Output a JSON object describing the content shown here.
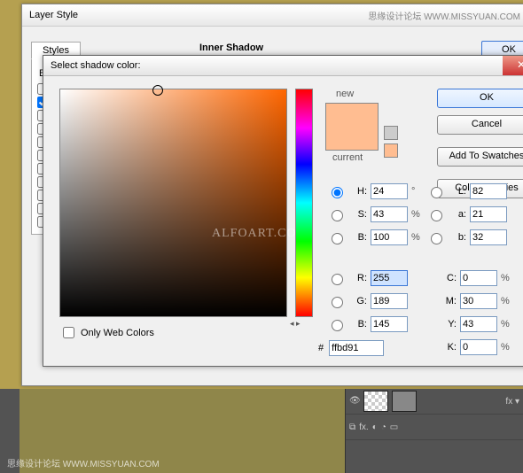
{
  "outer": {
    "title": "Layer Style",
    "watermark": "思缘设计论坛 WWW.MISSYUAN.COM",
    "styles_tab": "Styles",
    "ble_label": "Ble",
    "section": "Inner Shadow",
    "ok": "OK"
  },
  "picker": {
    "title": "Select shadow color:",
    "new_label": "new",
    "current_label": "current",
    "buttons": {
      "ok": "OK",
      "cancel": "Cancel",
      "add": "Add To Swatches",
      "libs": "Color Libraries"
    },
    "hsb": {
      "H": "24",
      "S": "43",
      "B": "100"
    },
    "lab": {
      "L": "82",
      "a": "21",
      "b": "32"
    },
    "rgb": {
      "R": "255",
      "G": "189",
      "B": "145"
    },
    "cmyk": {
      "C": "0",
      "M": "30",
      "Y": "43",
      "K": "0"
    },
    "hex": "ffbd91",
    "owc": "Only Web Colors",
    "alfo": "ALFOART.COM"
  },
  "bottom_wm": "思缘设计论坛 WWW.MISSYUAN.COM"
}
